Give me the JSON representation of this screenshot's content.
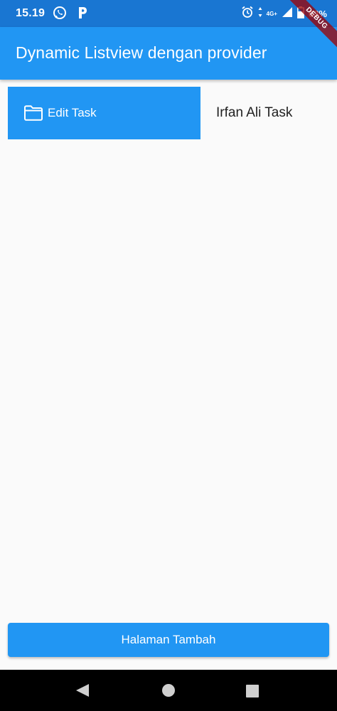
{
  "status_bar": {
    "time": "15.19",
    "network": "4G+",
    "battery": "63%",
    "icons": [
      "whatsapp-icon",
      "p-app-icon",
      "alarm-icon",
      "network-arrows-icon",
      "signal-icon",
      "battery-icon"
    ]
  },
  "debug_banner": {
    "label": "DEBUG"
  },
  "app_bar": {
    "title": "Dynamic Listview dengan provider"
  },
  "tasks": [
    {
      "action_label": "Edit Task",
      "action_icon": "folder-icon",
      "title": "Irfan Ali Task"
    }
  ],
  "bottom_button": {
    "label": "Halaman Tambah"
  },
  "nav_bar": {
    "icons": [
      "back-icon",
      "home-icon",
      "recents-icon"
    ]
  },
  "colors": {
    "status_bar": "#1976d2",
    "primary": "#2196f3",
    "background": "#fafafa",
    "text": "#212121",
    "nav_bar": "#000000",
    "debug_ribbon": "#a00000"
  }
}
